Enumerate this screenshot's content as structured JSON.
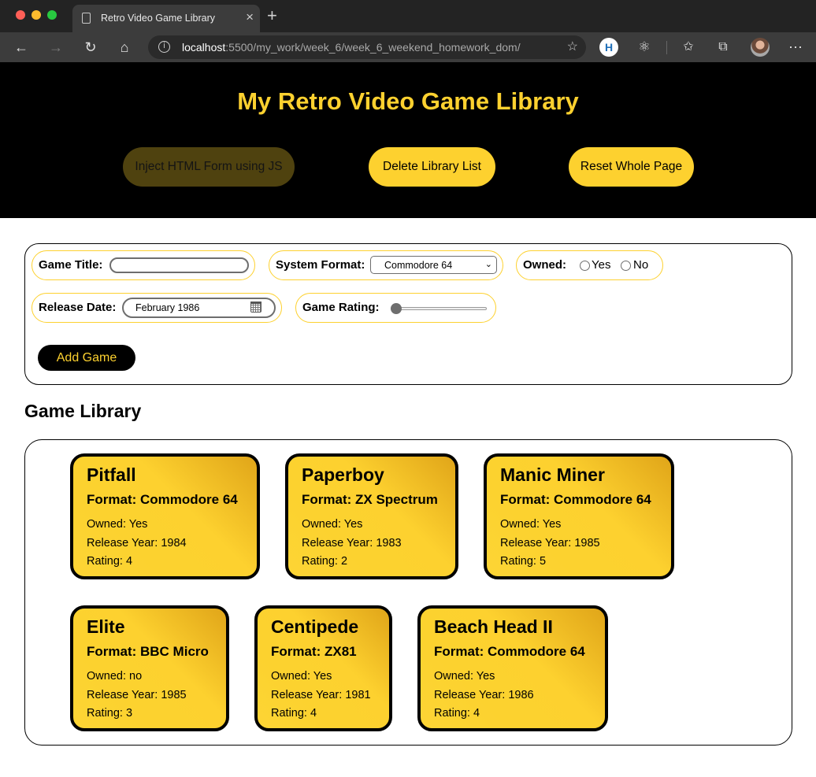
{
  "browser": {
    "tab_title": "Retro Video Game Library",
    "url_host": "localhost",
    "url_rest": ":5500/my_work/week_6/week_6_weekend_homework_dom/",
    "info_icon": "i",
    "extension_h_label": "H"
  },
  "page": {
    "title": "My Retro Video Game Library",
    "header_buttons": {
      "inject": "Inject HTML Form using JS",
      "delete": "Delete Library List",
      "reset": "Reset Whole Page"
    },
    "accent_color": "#fdd12f"
  },
  "form": {
    "title_label": "Game Title:",
    "title_value": "",
    "format_label": "System Format:",
    "format_value": "Commodore 64",
    "owned_label": "Owned:",
    "owned_yes": "Yes",
    "owned_no": "No",
    "date_label": "Release Date:",
    "date_value": "February 1986",
    "rating_label": "Game Rating:",
    "rating_level": 0,
    "add_button": "Add Game"
  },
  "library": {
    "heading": "Game Library",
    "games": [
      {
        "title": "Pitfall",
        "format": "Format: Commodore 64",
        "owned": "Owned: Yes",
        "year": "Release Year: 1984",
        "rating": "Rating: 4"
      },
      {
        "title": "Paperboy",
        "format": "Format: ZX Spectrum",
        "owned": "Owned: Yes",
        "year": "Release Year: 1983",
        "rating": "Rating: 2"
      },
      {
        "title": "Manic Miner",
        "format": "Format: Commodore 64",
        "owned": "Owned: Yes",
        "year": "Release Year: 1985",
        "rating": "Rating: 5"
      },
      {
        "title": "Elite",
        "format": "Format: BBC Micro",
        "owned": "Owned: no",
        "year": "Release Year: 1985",
        "rating": "Rating: 3"
      },
      {
        "title": "Centipede",
        "format": "Format: ZX81",
        "owned": "Owned: Yes",
        "year": "Release Year: 1981",
        "rating": "Rating: 4"
      },
      {
        "title": "Beach Head II",
        "format": "Format: Commodore 64",
        "owned": "Owned: Yes",
        "year": "Release Year: 1986",
        "rating": "Rating: 4"
      }
    ]
  }
}
